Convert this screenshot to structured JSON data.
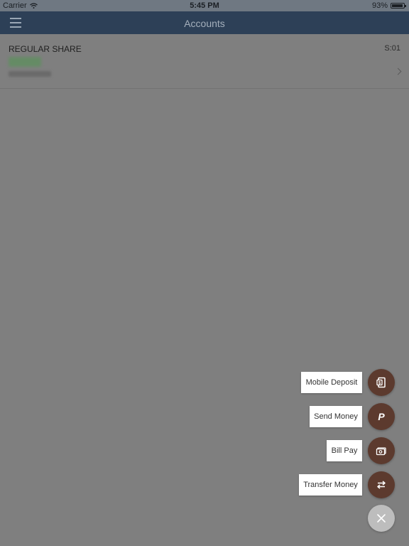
{
  "status_bar": {
    "carrier": "Carrier",
    "time": "5:45 PM",
    "battery": "93%",
    "battery_level": 0.93
  },
  "nav": {
    "title": "Accounts",
    "menu_icon": "hamburger-icon"
  },
  "account": {
    "name": "REGULAR SHARE",
    "suffix": "S:01",
    "chevron_icon": "chevron-right-icon"
  },
  "actions": [
    {
      "label": "Mobile Deposit",
      "icon": "mobile-deposit-icon"
    },
    {
      "label": "Send Money",
      "icon": "paypal-icon"
    },
    {
      "label": "Bill Pay",
      "icon": "bill-pay-icon"
    },
    {
      "label": "Transfer Money",
      "icon": "transfer-icon"
    }
  ],
  "close_icon": "close-icon",
  "colors": {
    "nav_background": "#2d4057",
    "fab_background": "#5c3a2e",
    "close_background": "#bdbdbd",
    "overlay": "#7f7f7f"
  }
}
